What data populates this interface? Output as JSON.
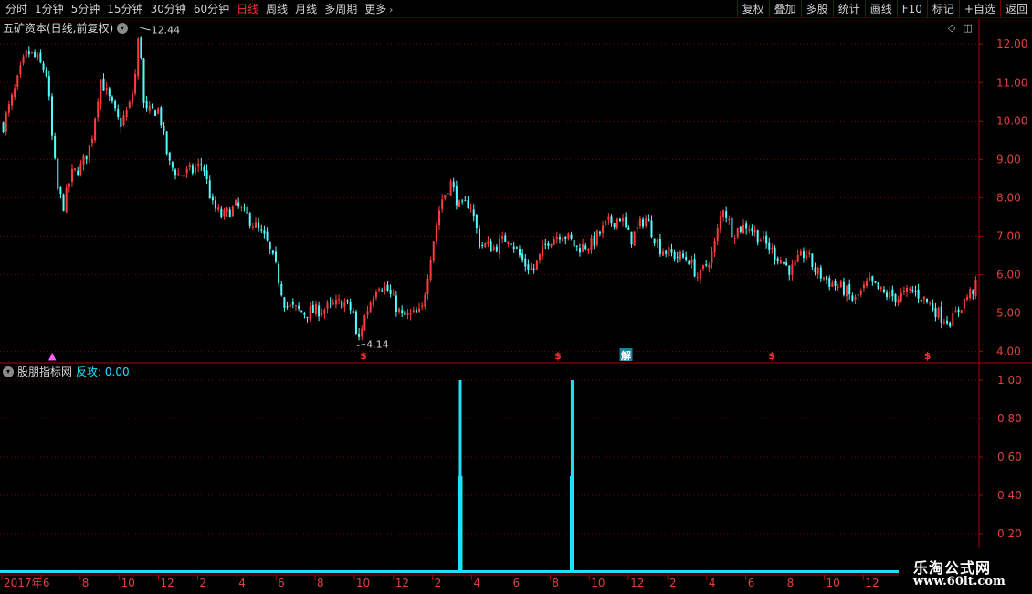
{
  "toolbar": {
    "periods": [
      "分时",
      "1分钟",
      "5分钟",
      "15分钟",
      "30分钟",
      "60分钟",
      "日线",
      "周线",
      "月线",
      "多周期"
    ],
    "more": "更多",
    "active": "日线",
    "buttons": [
      "复权",
      "叠加",
      "多股",
      "统计",
      "画线",
      "F10",
      "标记",
      "+自选",
      "返回"
    ]
  },
  "stock": {
    "title": "五矿资本(日线,前复权)",
    "high_label": "12.44",
    "low_label": "4.14",
    "price_axis": [
      "12.00",
      "11.00",
      "10.00",
      "9.00",
      "8.00",
      "7.00",
      "6.00",
      "5.00",
      "4.00"
    ],
    "markers": [
      {
        "text": "▲",
        "pos": 0.05,
        "color": "#ff60ff"
      },
      {
        "text": "$",
        "pos": 0.37,
        "color": "#ff3030"
      },
      {
        "text": "$",
        "pos": 0.57,
        "color": "#ff3030"
      },
      {
        "text": "解",
        "pos": 0.64,
        "color": "#ffffff",
        "boxed": true
      },
      {
        "text": "$",
        "pos": 0.79,
        "color": "#ff3030"
      },
      {
        "text": "$",
        "pos": 0.95,
        "color": "#ff3030"
      }
    ]
  },
  "indicator": {
    "name": "股朋指标网",
    "label": "反攻: 0.00",
    "axis": [
      "1.00",
      "0.80",
      "0.60",
      "0.40",
      "0.20"
    ],
    "spikes": [
      0.47,
      0.585
    ],
    "color": "#20e0ff"
  },
  "date_axis": [
    "2017年",
    "6",
    "8",
    "10",
    "12",
    "2",
    "4",
    "6",
    "8",
    "10",
    "12",
    "2",
    "4",
    "6",
    "8",
    "10",
    "12",
    "2",
    "4",
    "6",
    "8",
    "10",
    "12",
    "2",
    "4"
  ],
  "watermark": {
    "title": "乐淘公式网",
    "url": "www.60lt.com"
  },
  "chart_data": {
    "type": "candlestick",
    "ylim": [
      3.8,
      12.6
    ],
    "waypoints": [
      [
        0,
        9.9
      ],
      [
        0.012,
        10.8
      ],
      [
        0.02,
        11.5
      ],
      [
        0.025,
        11.8
      ],
      [
        0.035,
        11.6
      ],
      [
        0.045,
        11.2
      ],
      [
        0.05,
        9.6
      ],
      [
        0.056,
        8.2
      ],
      [
        0.062,
        7.8
      ],
      [
        0.07,
        8.6
      ],
      [
        0.08,
        8.8
      ],
      [
        0.09,
        9.4
      ],
      [
        0.1,
        11.1
      ],
      [
        0.11,
        10.5
      ],
      [
        0.12,
        9.9
      ],
      [
        0.13,
        10.4
      ],
      [
        0.135,
        11.0
      ],
      [
        0.14,
        12.44
      ],
      [
        0.145,
        10.2
      ],
      [
        0.16,
        10.3
      ],
      [
        0.17,
        8.9
      ],
      [
        0.18,
        8.6
      ],
      [
        0.195,
        8.7
      ],
      [
        0.205,
        8.9
      ],
      [
        0.215,
        7.8
      ],
      [
        0.225,
        7.5
      ],
      [
        0.24,
        7.8
      ],
      [
        0.255,
        7.4
      ],
      [
        0.27,
        6.9
      ],
      [
        0.28,
        6.2
      ],
      [
        0.29,
        5.2
      ],
      [
        0.31,
        5.0
      ],
      [
        0.33,
        5.1
      ],
      [
        0.35,
        5.3
      ],
      [
        0.36,
        5.0
      ],
      [
        0.364,
        4.14
      ],
      [
        0.37,
        4.8
      ],
      [
        0.385,
        5.8
      ],
      [
        0.395,
        5.6
      ],
      [
        0.41,
        4.9
      ],
      [
        0.43,
        5.0
      ],
      [
        0.44,
        6.6
      ],
      [
        0.45,
        7.9
      ],
      [
        0.46,
        8.4
      ],
      [
        0.47,
        7.7
      ],
      [
        0.48,
        7.9
      ],
      [
        0.49,
        6.8
      ],
      [
        0.505,
        6.7
      ],
      [
        0.52,
        7.0
      ],
      [
        0.535,
        6.3
      ],
      [
        0.545,
        6.1
      ],
      [
        0.56,
        6.9
      ],
      [
        0.575,
        7.1
      ],
      [
        0.59,
        6.7
      ],
      [
        0.605,
        6.8
      ],
      [
        0.62,
        7.3
      ],
      [
        0.635,
        7.5
      ],
      [
        0.645,
        6.9
      ],
      [
        0.66,
        7.5
      ],
      [
        0.675,
        6.7
      ],
      [
        0.69,
        6.5
      ],
      [
        0.705,
        6.4
      ],
      [
        0.715,
        5.9
      ],
      [
        0.73,
        6.6
      ],
      [
        0.74,
        7.8
      ],
      [
        0.75,
        7.1
      ],
      [
        0.765,
        7.3
      ],
      [
        0.78,
        6.9
      ],
      [
        0.795,
        6.5
      ],
      [
        0.81,
        6.1
      ],
      [
        0.825,
        6.6
      ],
      [
        0.835,
        6.1
      ],
      [
        0.85,
        5.8
      ],
      [
        0.865,
        5.6
      ],
      [
        0.875,
        5.3
      ],
      [
        0.89,
        5.8
      ],
      [
        0.905,
        5.5
      ],
      [
        0.92,
        5.4
      ],
      [
        0.935,
        5.6
      ],
      [
        0.95,
        5.3
      ],
      [
        0.965,
        4.9
      ],
      [
        0.975,
        4.8
      ],
      [
        0.99,
        5.4
      ],
      [
        1.0,
        5.7
      ]
    ]
  }
}
